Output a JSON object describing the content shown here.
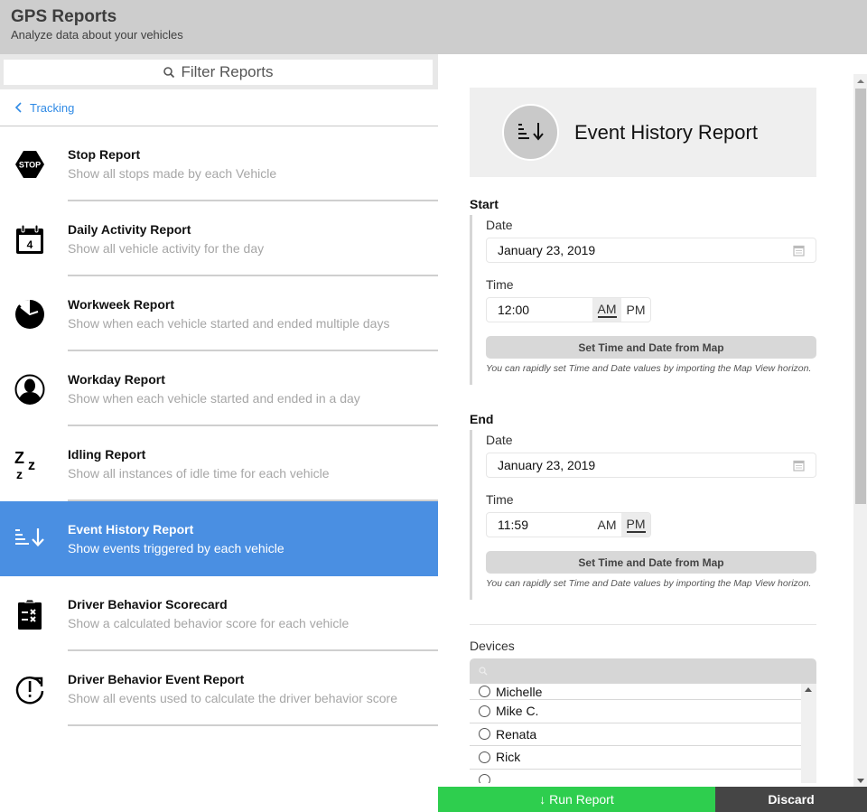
{
  "header": {
    "title": "GPS Reports",
    "subtitle": "Analyze data about your vehicles"
  },
  "filter": {
    "placeholder": "Filter Reports",
    "icon": "search-icon"
  },
  "breadcrumb": {
    "label": "Tracking",
    "icon": "chevron-left-icon"
  },
  "reports": [
    {
      "title": "Stop Report",
      "description": "Show all stops made by each Vehicle",
      "icon": "stop-sign-icon",
      "selected": false
    },
    {
      "title": "Daily Activity Report",
      "description": "Show all vehicle activity for the day",
      "icon": "calendar-icon",
      "selected": false
    },
    {
      "title": "Workweek Report",
      "description": "Show when each vehicle started and ended multiple days",
      "icon": "clock-icon",
      "selected": false
    },
    {
      "title": "Workday Report",
      "description": "Show when each vehicle started and ended in a day",
      "icon": "person-icon",
      "selected": false
    },
    {
      "title": "Idling Report",
      "description": "Show all instances of idle time for each vehicle",
      "icon": "sleep-zzz-icon",
      "selected": false
    },
    {
      "title": "Event History Report",
      "description": "Show events triggered by each vehicle",
      "icon": "sort-descending-icon",
      "selected": true
    },
    {
      "title": "Driver Behavior Scorecard",
      "description": "Show a calculated behavior score for each vehicle",
      "icon": "clipboard-icon",
      "selected": false
    },
    {
      "title": "Driver Behavior Event Report",
      "description": "Show all events used to calculate the driver behavior score",
      "icon": "alert-refresh-icon",
      "selected": false
    }
  ],
  "detail": {
    "title": "Event History Report",
    "icon": "sort-descending-icon",
    "start": {
      "label": "Start",
      "date_label": "Date",
      "date_value": "January 23, 2019",
      "time_label": "Time",
      "time_value": "12:00",
      "am_label": "AM",
      "pm_label": "PM",
      "meridiem": "AM",
      "map_button": "Set Time and Date from Map",
      "hint": "You can rapidly set Time and Date values by importing the Map View horizon."
    },
    "end": {
      "label": "End",
      "date_label": "Date",
      "date_value": "January 23, 2019",
      "time_label": "Time",
      "time_value": "11:59",
      "am_label": "AM",
      "pm_label": "PM",
      "meridiem": "PM",
      "map_button": "Set Time and Date from Map",
      "hint": "You can rapidly set Time and Date values by importing the Map View horizon."
    },
    "devices": {
      "label": "Devices",
      "search_placeholder": "",
      "items": [
        "Michelle",
        "Mike C.",
        "Renata",
        "Rick",
        ""
      ]
    }
  },
  "footer": {
    "run_label": "↓ Run Report",
    "discard_label": "Discard"
  },
  "colors": {
    "selected": "#4a8fe2",
    "run": "#2ece4e",
    "discard": "#454545",
    "link": "#2f8ae5"
  }
}
